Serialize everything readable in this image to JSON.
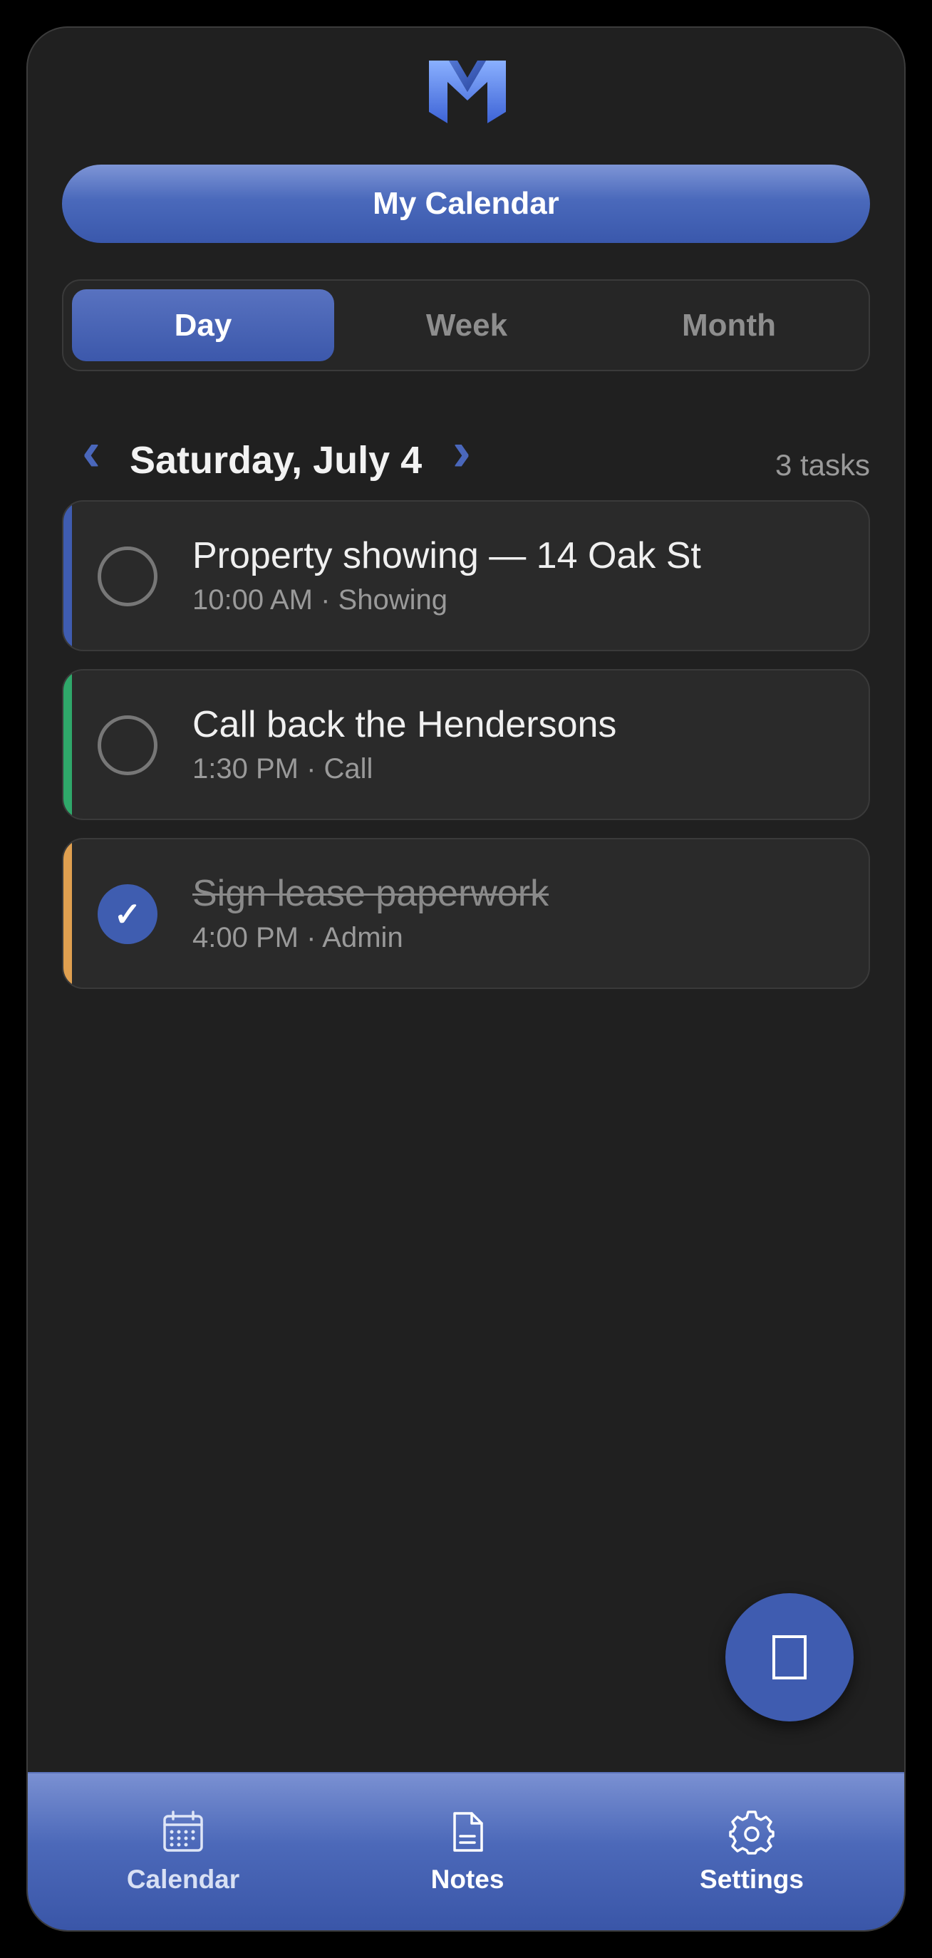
{
  "app": {
    "title": "My Calendar",
    "colors": {
      "accent": "#3f5cb0",
      "background": "#202020",
      "card": "#2a2a2a"
    }
  },
  "view_switch": {
    "tabs": [
      {
        "label": "Day",
        "active": true
      },
      {
        "label": "Week",
        "active": false
      },
      {
        "label": "Month",
        "active": false
      }
    ]
  },
  "date_nav": {
    "prev_icon": "chevron-left-icon",
    "next_icon": "chevron-right-icon",
    "date_label": "Saturday, July 4",
    "task_count": "3 tasks"
  },
  "tasks": [
    {
      "title": "Property showing — 14 Oak St",
      "meta": "10:00 AM · Showing",
      "done": false,
      "color": "#3f5cb0"
    },
    {
      "title": "Call back the Hendersons",
      "meta": "1:30 PM · Call",
      "done": false,
      "color": "#2fa86a"
    },
    {
      "title": "Sign lease paperwork",
      "meta": "4:00 PM · Admin",
      "done": true,
      "color": "#e0a050"
    }
  ],
  "fab": {
    "icon": "add-note-icon"
  },
  "bottom_nav": {
    "items": [
      {
        "label": "Calendar",
        "icon": "calendar-icon"
      },
      {
        "label": "Notes",
        "icon": "notes-icon"
      },
      {
        "label": "Settings",
        "icon": "gear-icon"
      }
    ]
  }
}
